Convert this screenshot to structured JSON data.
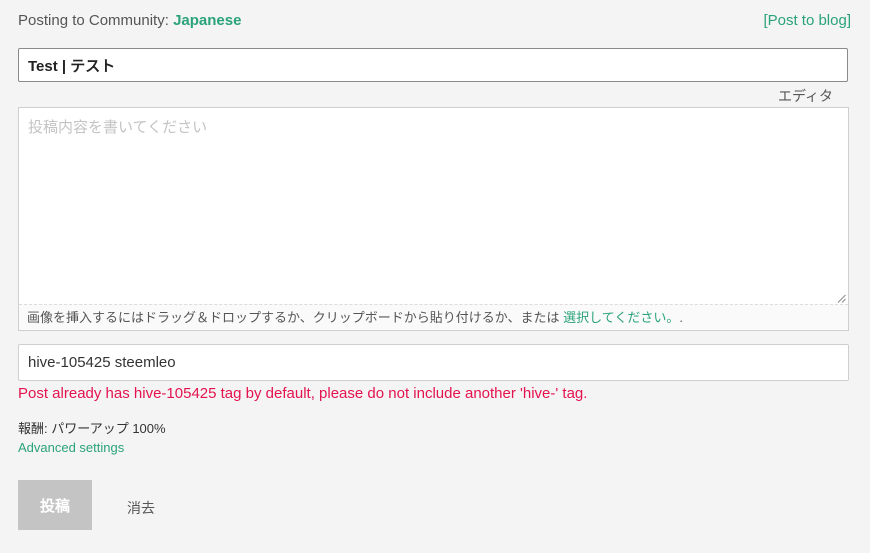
{
  "header": {
    "posting_label": "Posting to Community: ",
    "community_name": "Japanese",
    "post_to_blog": "[Post to blog]"
  },
  "title_field": {
    "value": "Test | テスト"
  },
  "editor_toggle": "エディタ",
  "body_field": {
    "value": "",
    "placeholder": "投稿内容を書いてください"
  },
  "dropzone": {
    "text": "画像を挿入するにはドラッグ＆ドロップするか、クリップボードから貼り付けるか、または ",
    "select_link": "選択してください。",
    "suffix": "."
  },
  "tags_field": {
    "value": "hive-105425 steemleo"
  },
  "tag_error": "Post already has hive-105425 tag by default, please do not include another 'hive-' tag.",
  "rewards": {
    "label": "報酬: ",
    "value": "パワーアップ 100%"
  },
  "advanced_settings": "Advanced settings",
  "actions": {
    "submit": "投稿",
    "clear": "消去"
  },
  "colors": {
    "accent": "#2ba37a",
    "error": "#e4134f",
    "disabled_button": "#c4c4c4",
    "background": "#f4f4f4"
  }
}
